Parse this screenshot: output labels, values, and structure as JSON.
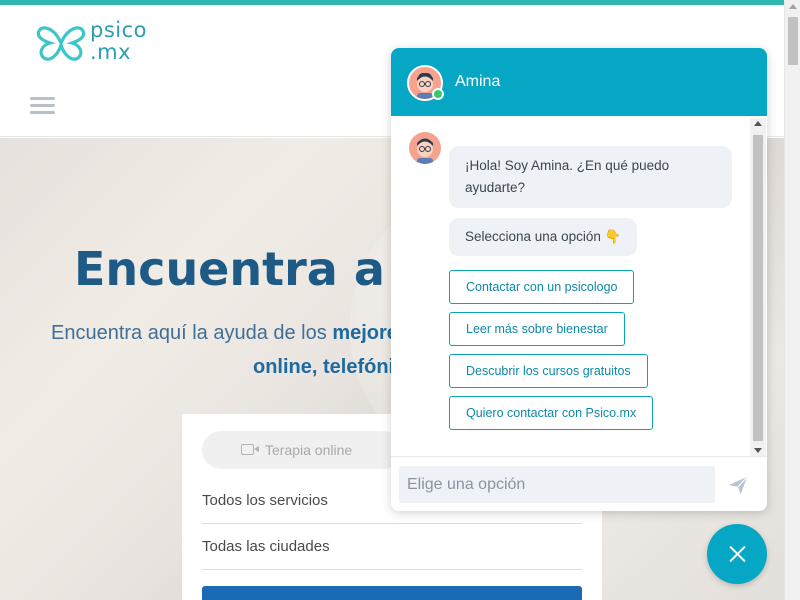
{
  "brand": {
    "logo_line1": "psico",
    "logo_line2": ".mx",
    "accent": "#2fb8ad"
  },
  "header": {
    "menu_icon": "hamburger-menu-icon"
  },
  "hero": {
    "title": "Encuentra a",
    "subtitle_prefix": "Encuentra aquí la ayuda de los ",
    "subtitle_bold": "mejores",
    "subtitle_line2": "online, telefóni",
    "tab_label": "Terapia online",
    "service_field": "Todos los servicios",
    "city_field": "Todas las ciudades"
  },
  "chat": {
    "agent_name": "Amina",
    "greeting": "¡Hola! Soy Amina. ¿En qué puedo ayudarte?",
    "prompt": "Selecciona una opción 👇",
    "options": [
      "Contactar con un psicologo",
      "Leer más sobre bienestar",
      "Descubrir los cursos gratuitos",
      "Quiero contactar con Psico.mx"
    ],
    "input_placeholder": "Elige una opción",
    "header_color": "#05a7c4",
    "status": "online"
  }
}
